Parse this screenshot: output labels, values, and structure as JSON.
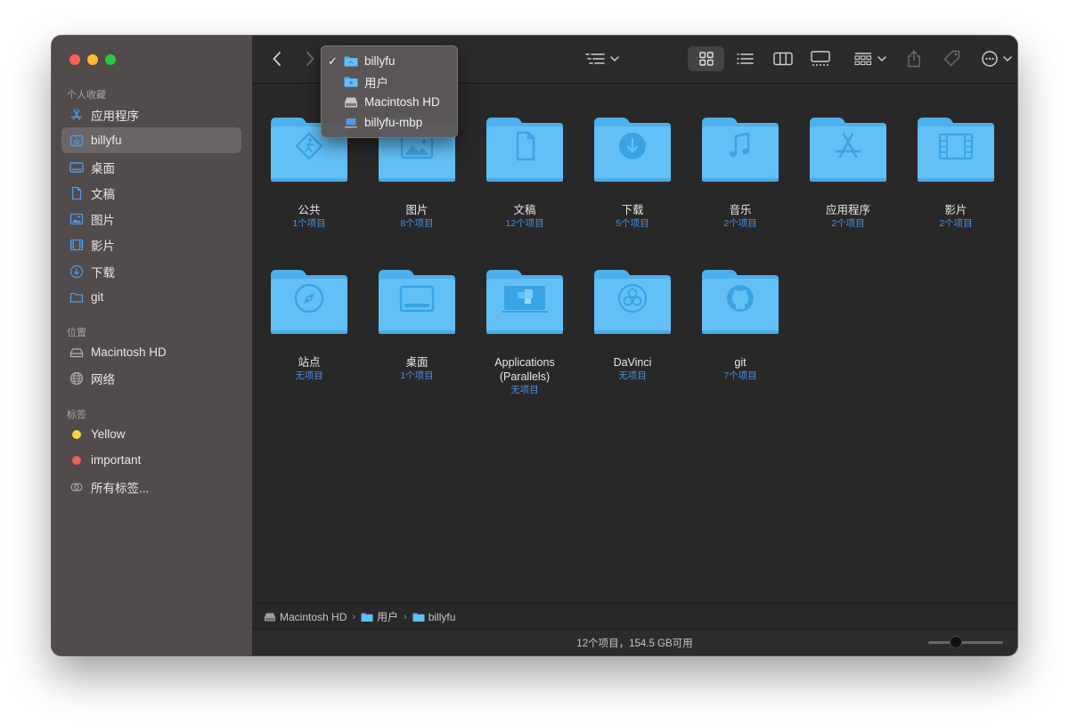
{
  "colors": {
    "accent": "#4a8fe0",
    "folder": "#63c0f7",
    "folder_tab": "#4db0ee",
    "folder_icon": "#3aa3e4",
    "sidebar_icon": "#4d9ae8"
  },
  "sidebar": {
    "section_favorites": "个人收藏",
    "favorites": [
      {
        "label": "应用程序",
        "icon": "app-store-icon"
      },
      {
        "label": "billyfu",
        "icon": "home-icon",
        "selected": true
      },
      {
        "label": "桌面",
        "icon": "desktop-icon"
      },
      {
        "label": "文稿",
        "icon": "document-icon"
      },
      {
        "label": "图片",
        "icon": "photo-icon"
      },
      {
        "label": "影片",
        "icon": "film-icon"
      },
      {
        "label": "下载",
        "icon": "download-icon"
      },
      {
        "label": "git",
        "icon": "folder-icon"
      }
    ],
    "section_locations": "位置",
    "locations": [
      {
        "label": "Macintosh HD",
        "icon": "disk-icon"
      },
      {
        "label": "网络",
        "icon": "globe-icon"
      }
    ],
    "section_tags": "标签",
    "tags": [
      {
        "label": "Yellow",
        "color": "#f5d742"
      },
      {
        "label": "important",
        "color": "#ec5f5a"
      },
      {
        "label": "所有标签...",
        "icon": "all-tags-icon"
      }
    ]
  },
  "path_menu": {
    "items": [
      {
        "label": "billyfu",
        "checked": true,
        "icon": "home-folder-icon"
      },
      {
        "label": "用户",
        "checked": false,
        "icon": "users-folder-icon"
      },
      {
        "label": "Macintosh HD",
        "checked": false,
        "icon": "disk-icon"
      },
      {
        "label": "billyfu-mbp",
        "checked": false,
        "icon": "laptop-icon"
      }
    ],
    "check_mark": "✓"
  },
  "items": [
    {
      "name": "公共",
      "count": "1个项目",
      "icon": "public-icon"
    },
    {
      "name": "图片",
      "count": "8个项目",
      "icon": "photo-icon"
    },
    {
      "name": "文稿",
      "count": "12个项目",
      "icon": "document-icon"
    },
    {
      "name": "下载",
      "count": "5个项目",
      "icon": "download-icon"
    },
    {
      "name": "音乐",
      "count": "2个项目",
      "icon": "music-icon"
    },
    {
      "name": "应用程序",
      "count": "2个项目",
      "icon": "app-store-icon"
    },
    {
      "name": "影片",
      "count": "2个项目",
      "icon": "film-icon"
    },
    {
      "name": "站点",
      "count": "无项目",
      "icon": "compass-icon"
    },
    {
      "name": "桌面",
      "count": "1个项目",
      "icon": "desktop-icon"
    },
    {
      "name": "Applications (Parallels)",
      "count": "无项目",
      "icon": "parallels-icon"
    },
    {
      "name": "DaVinci",
      "count": "无项目",
      "icon": "davinci-icon"
    },
    {
      "name": "git",
      "count": "7个项目",
      "icon": "github-icon"
    }
  ],
  "pathbar": [
    {
      "label": "Macintosh HD",
      "icon": "disk-icon"
    },
    {
      "label": "用户",
      "icon": "users-folder-icon"
    },
    {
      "label": "billyfu",
      "icon": "home-folder-icon"
    }
  ],
  "pathbar_separator": "›",
  "status": {
    "text": "12个项目，154.5 GB可用"
  }
}
